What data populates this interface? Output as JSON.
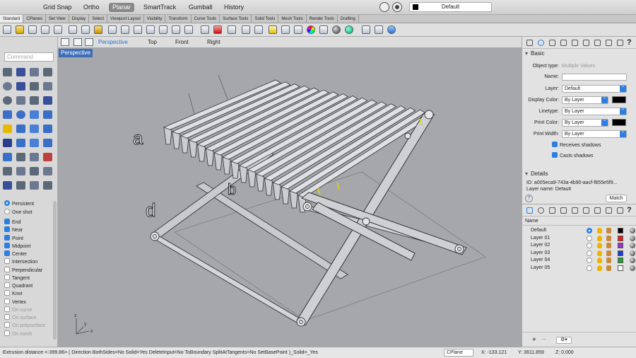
{
  "topbar": {
    "grid_snap": "Grid Snap",
    "ortho": "Ortho",
    "planar": "Planar",
    "smarttrack": "SmartTrack",
    "gumball": "Gumball",
    "history": "History",
    "current_layer": "Default"
  },
  "tabs": [
    "Standard",
    "CPlanes",
    "Set View",
    "Display",
    "Select",
    "Viewport Layout",
    "Visibility",
    "Transform",
    "Curve Tools",
    "Surface Tools",
    "Solid Tools",
    "Mesh Tools",
    "Render Tools",
    "Drafting"
  ],
  "command": {
    "placeholder": "Command"
  },
  "viewport_tabs": [
    "Perspective",
    "Top",
    "Front",
    "Right"
  ],
  "viewport": {
    "label": "Perspective",
    "annotations": {
      "a": "a",
      "b": "b",
      "d": "d"
    },
    "axis": {
      "x": "x",
      "y": "y",
      "z": "z"
    }
  },
  "osnap": {
    "mode_persistent": "Persistent",
    "mode_one_shot": "One shot",
    "items": [
      {
        "label": "End",
        "checked": true,
        "enabled": true
      },
      {
        "label": "Near",
        "checked": true,
        "enabled": true
      },
      {
        "label": "Point",
        "checked": true,
        "enabled": true
      },
      {
        "label": "Midpoint",
        "checked": true,
        "enabled": true
      },
      {
        "label": "Center",
        "checked": true,
        "enabled": true
      },
      {
        "label": "Intersection",
        "checked": false,
        "enabled": true
      },
      {
        "label": "Perpendicular",
        "checked": false,
        "enabled": true
      },
      {
        "label": "Tangent",
        "checked": false,
        "enabled": true
      },
      {
        "label": "Quadrant",
        "checked": false,
        "enabled": true
      },
      {
        "label": "Knot",
        "checked": false,
        "enabled": true
      },
      {
        "label": "Vertex",
        "checked": false,
        "enabled": true
      },
      {
        "label": "On curve",
        "checked": false,
        "enabled": false
      },
      {
        "label": "On surface",
        "checked": false,
        "enabled": false
      },
      {
        "label": "On polysurface",
        "checked": false,
        "enabled": false
      },
      {
        "label": "On mesh",
        "checked": false,
        "enabled": false
      }
    ]
  },
  "properties": {
    "section_basic": "Basic",
    "object_type_label": "Object type:",
    "object_type_value": "Multiple Values",
    "name_label": "Name:",
    "layer_label": "Layer:",
    "layer_value": "Default",
    "display_color_label": "Display Color:",
    "display_color_value": "By Layer",
    "linetype_label": "Linetype:",
    "linetype_value": "By Layer",
    "print_color_label": "Print Color:",
    "print_color_value": "By Layer",
    "print_width_label": "Print Width:",
    "print_width_value": "By Layer",
    "receives_shadows": "Receives shadows",
    "casts_shadows": "Casts shadows",
    "section_details": "Details",
    "id_text": "ID: a005eca9-743a-4b90-aacf-f855e5f9...",
    "layer_name_text": "Layer name: Default",
    "help": "?",
    "match_button": "Match"
  },
  "layers": {
    "header_name": "Name",
    "items": [
      {
        "name": "Default",
        "color": "#000000",
        "current": true
      },
      {
        "name": "Layer 01",
        "color": "#e02020",
        "current": false
      },
      {
        "name": "Layer 02",
        "color": "#9b30d0",
        "current": false
      },
      {
        "name": "Layer 03",
        "color": "#1a3ee0",
        "current": false
      },
      {
        "name": "Layer 04",
        "color": "#20a030",
        "current": false
      },
      {
        "name": "Layer 05",
        "color": "#ffffff",
        "current": false
      }
    ]
  },
  "status": {
    "command_text": "Extrusion distance <-399.86> ( Direction BothSides=No Solid=Yes DeleteInput=No ToBoundary SplitAtTangents=No SetBasePoint )_Solid=_Yes",
    "cplane": "CPlane",
    "x": "X: -133.121",
    "y": "Y: 3611.859",
    "z": "Z: 0.000"
  }
}
